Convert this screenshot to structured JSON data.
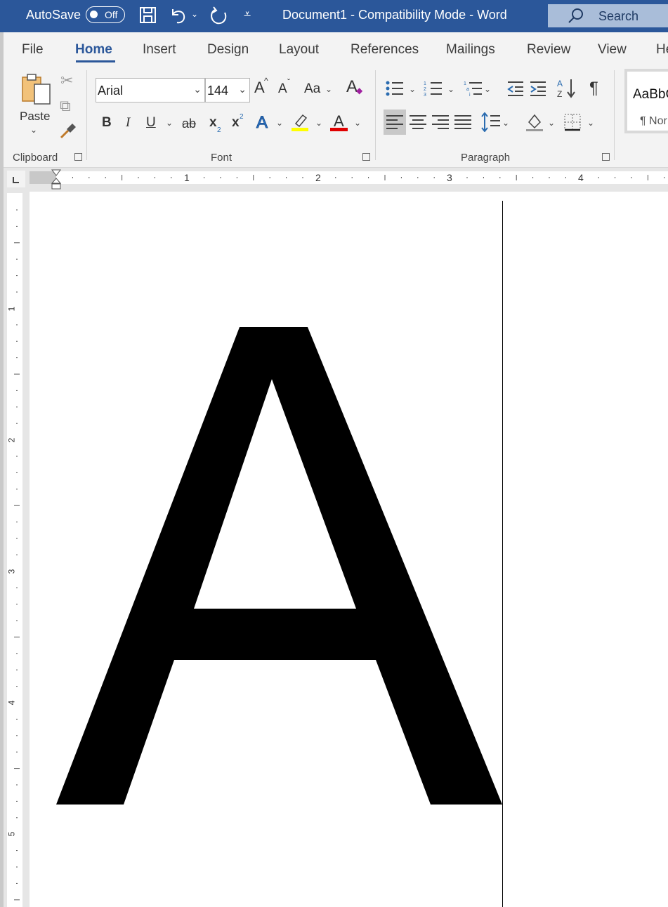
{
  "titlebar": {
    "autosave_label": "AutoSave",
    "autosave_state": "Off",
    "document_title": "Document1  -  Compatibility Mode  -  Word",
    "search_label": "Search",
    "icons": [
      "save-icon",
      "undo-icon",
      "redo-icon",
      "customize-qat-icon",
      "search-icon"
    ]
  },
  "menu": {
    "tabs": [
      "File",
      "Home",
      "Insert",
      "Design",
      "Layout",
      "References",
      "Mailings",
      "Review",
      "View",
      "He"
    ],
    "active": "Home"
  },
  "ribbon": {
    "clipboard": {
      "paste_label": "Paste",
      "group_label": "Clipboard"
    },
    "font": {
      "font_name": "Arial",
      "font_size": "144",
      "grow_label": "A",
      "shrink_label": "A",
      "case_label": "Aa",
      "bold": "B",
      "italic": "I",
      "underline": "U",
      "strike": "ab",
      "subscript": "x",
      "subscript_mark": "2",
      "superscript": "x",
      "superscript_mark": "2",
      "text_effects": "A",
      "font_color": "A",
      "group_label": "Font",
      "highlight_color": "#ffff00",
      "font_color_value": "#e00000"
    },
    "paragraph": {
      "group_label": "Paragraph",
      "pilcrow": "¶"
    },
    "styles": {
      "preview": "AaBbC",
      "name": "¶ Nor"
    }
  },
  "ruler": {
    "horizontal_numbers": [
      "1",
      "2",
      "3",
      "4"
    ],
    "vertical_numbers": [
      "1",
      "2",
      "3",
      "4",
      "5"
    ]
  },
  "document": {
    "text": "A"
  }
}
